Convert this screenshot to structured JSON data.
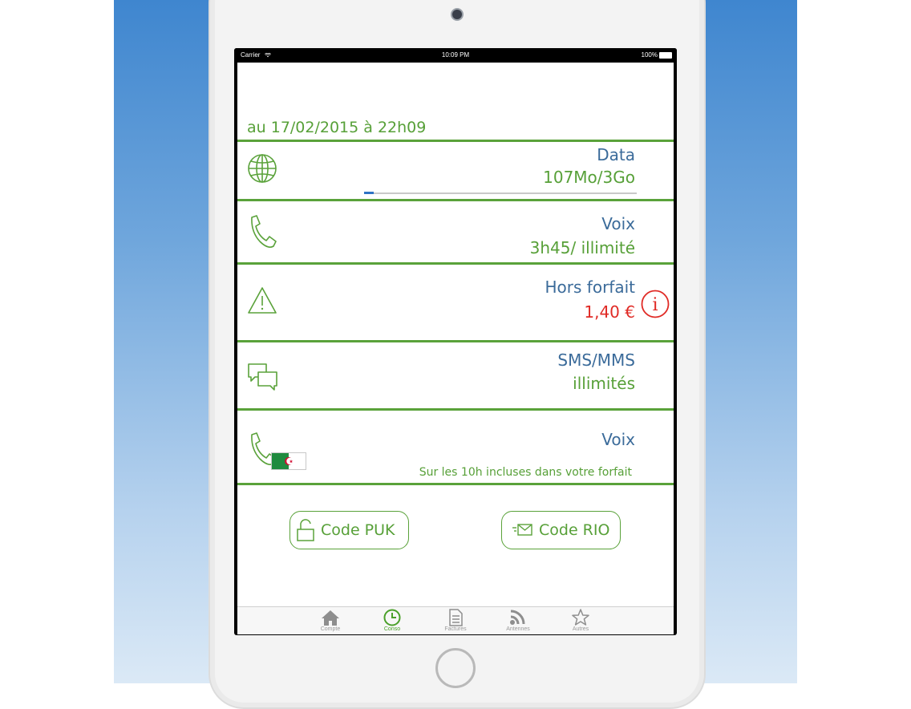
{
  "status_bar": {
    "carrier": "Carrier",
    "time": "10:09 PM",
    "battery": "100%"
  },
  "header": {
    "date": "au 17/02/2015 à 22h09"
  },
  "rows": [
    {
      "icon": "globe-icon",
      "label": "Data",
      "value": "107Mo/3Go",
      "progress": 0.035
    },
    {
      "icon": "phone-icon",
      "label": "Voix",
      "value": "3h45/ illimité"
    },
    {
      "icon": "warning-icon",
      "label": "Hors forfait",
      "value": "1,40 €",
      "info_icon": "info-icon"
    },
    {
      "icon": "chat-icon",
      "label": "SMS/MMS",
      "value": "illimités"
    },
    {
      "icon": "phone-flag-icon",
      "label": "Voix",
      "note": "Sur les 10h incluses dans votre forfait"
    }
  ],
  "buttons": {
    "puk": "Code PUK",
    "rio": "Code RIO"
  },
  "tabs": [
    {
      "label": "Compte",
      "icon": "home-icon"
    },
    {
      "label": "Conso",
      "icon": "clock-icon",
      "active": true
    },
    {
      "label": "Factures",
      "icon": "document-icon"
    },
    {
      "label": "Antennes",
      "icon": "rss-icon"
    },
    {
      "label": "Autres",
      "icon": "star-icon"
    }
  ],
  "colors": {
    "green": "#5aa23a",
    "blue_label": "#3b6b9a",
    "red": "#e02a25",
    "progress": "#2f73c4"
  }
}
